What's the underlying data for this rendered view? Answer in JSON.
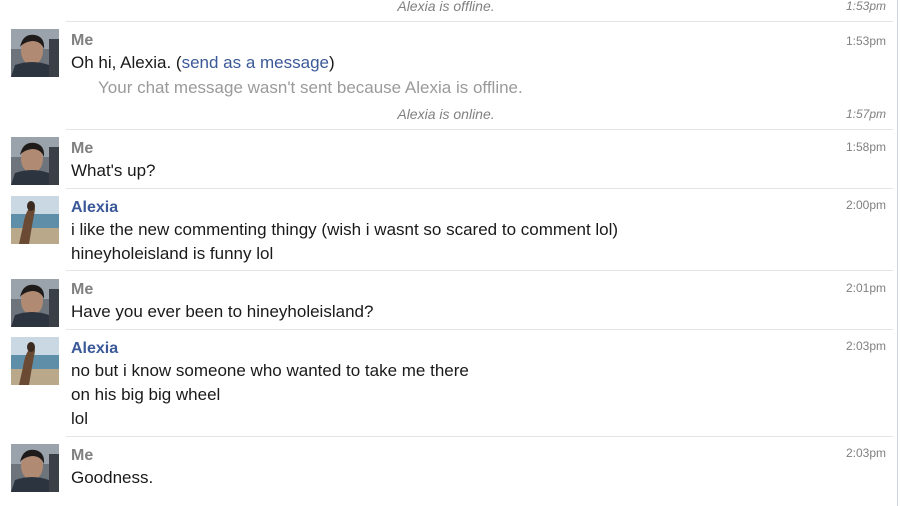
{
  "status_events": [
    {
      "text": "Alexia is offline.",
      "time": "1:53pm"
    },
    {
      "text": "Alexia is online.",
      "time": "1:57pm"
    }
  ],
  "messages": [
    {
      "sender": "Me",
      "time": "1:53pm",
      "text_prefix": "Oh hi, Alexia. (",
      "link_text": "send as a message",
      "text_suffix": ")",
      "error": "Your chat message wasn't sent because Alexia is offline."
    },
    {
      "sender": "Me",
      "time": "1:58pm",
      "lines": [
        "What's up?"
      ]
    },
    {
      "sender": "Alexia",
      "time": "2:00pm",
      "lines": [
        "i like the new commenting thingy (wish i wasnt so scared to comment lol)",
        "hineyholeisland is funny lol"
      ]
    },
    {
      "sender": "Me",
      "time": "2:01pm",
      "lines": [
        "Have you ever been to hineyholeisland?"
      ]
    },
    {
      "sender": "Alexia",
      "time": "2:03pm",
      "lines": [
        "no but i know someone who wanted to take me there",
        "on his big big wheel",
        "lol"
      ]
    },
    {
      "sender": "Me",
      "time": "2:03pm",
      "lines": [
        "Goodness."
      ]
    }
  ],
  "colors": {
    "link": "#3b5998",
    "sender_alexia": "#3b5998",
    "sender_me": "#808080",
    "status_text": "#808080",
    "error_text": "#9a9a9a"
  }
}
